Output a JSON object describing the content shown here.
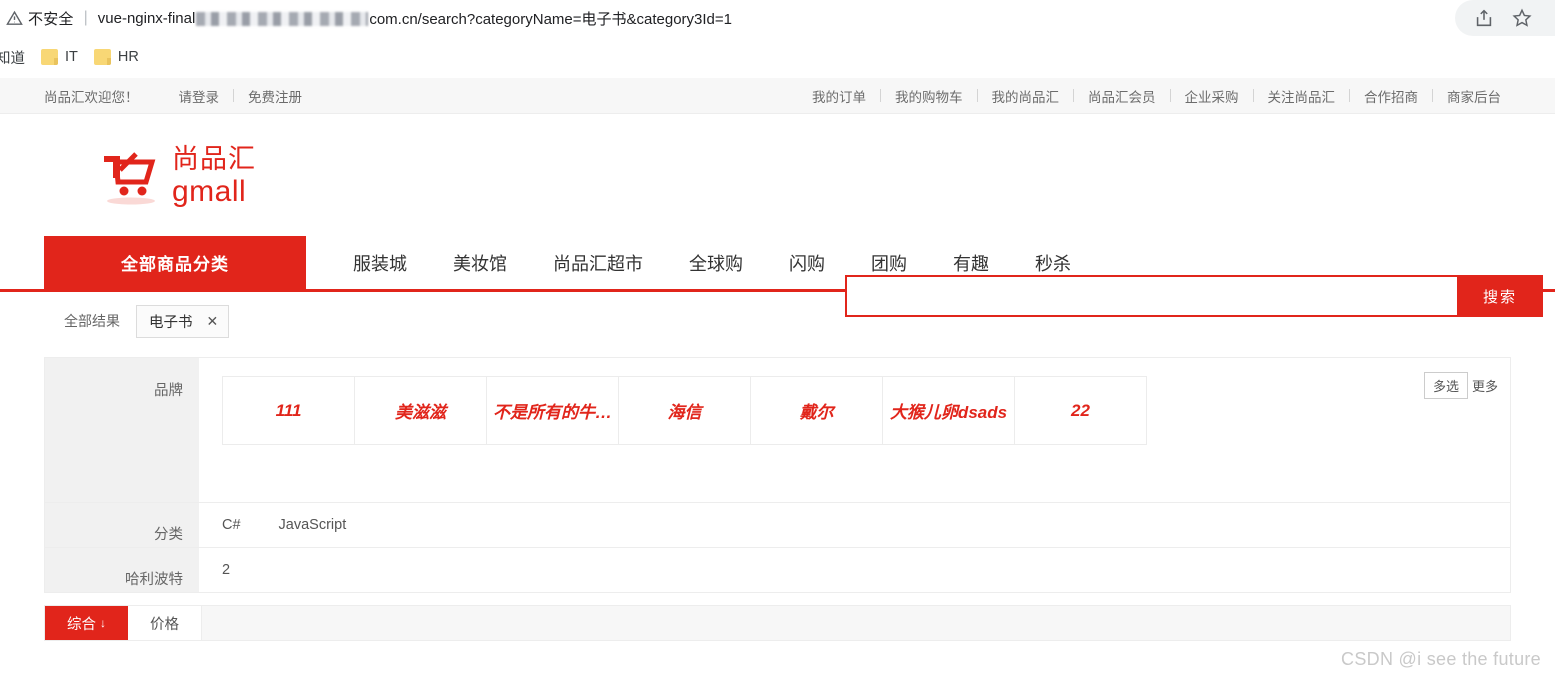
{
  "browser": {
    "security_label": "不安全",
    "url_prefix": "vue-nginx-final",
    "url_suffix": "com.cn/search?categoryName=电子书&category3Id=1",
    "share_icon": "share-icon",
    "star_icon": "star-icon",
    "bookmarks": [
      {
        "label": "知道",
        "icon": "none"
      },
      {
        "label": "IT",
        "icon": "folder-icon"
      },
      {
        "label": "HR",
        "icon": "folder-icon"
      }
    ]
  },
  "topbar": {
    "welcome": "尚品汇欢迎您！",
    "login": "请登录",
    "register": "免费注册",
    "links": [
      "我的订单",
      "我的购物车",
      "我的尚品汇",
      "尚品汇会员",
      "企业采购",
      "关注尚品汇",
      "合作招商",
      "商家后台"
    ]
  },
  "header": {
    "logo_cn": "尚品汇",
    "logo_en": "gmall",
    "search": {
      "value": "",
      "placeholder": "",
      "button_label": "搜索"
    }
  },
  "mainnav": {
    "all_categories": "全部商品分类",
    "links": [
      "服装城",
      "美妆馆",
      "尚品汇超市",
      "全球购",
      "闪购",
      "团购",
      "有趣",
      "秒杀"
    ]
  },
  "search_page": {
    "breadcrumb_all": "全部结果",
    "tag": {
      "label": "电子书",
      "close": "✕"
    },
    "filters": [
      {
        "label": "品牌",
        "type": "grid",
        "options": [
          "111",
          "美滋滋",
          "不是所有的牛…",
          "海信",
          "戴尔",
          "大猴儿卵dsads",
          "22"
        ],
        "multi_label": "多选",
        "more_label": "更多"
      },
      {
        "label": "分类",
        "type": "plain",
        "options": [
          "C#",
          "JavaScript"
        ]
      },
      {
        "label": "哈利波特",
        "type": "plain",
        "options": [
          "2"
        ]
      }
    ],
    "sort": [
      {
        "label": "综合",
        "arrow": "↓",
        "active": true
      },
      {
        "label": "价格",
        "arrow": "",
        "active": false
      }
    ]
  },
  "watermark": "CSDN @i see the future",
  "colors": {
    "brand_red": "#e1251b",
    "panel_gray": "#f1f1f1",
    "border_gray": "#ededed"
  }
}
